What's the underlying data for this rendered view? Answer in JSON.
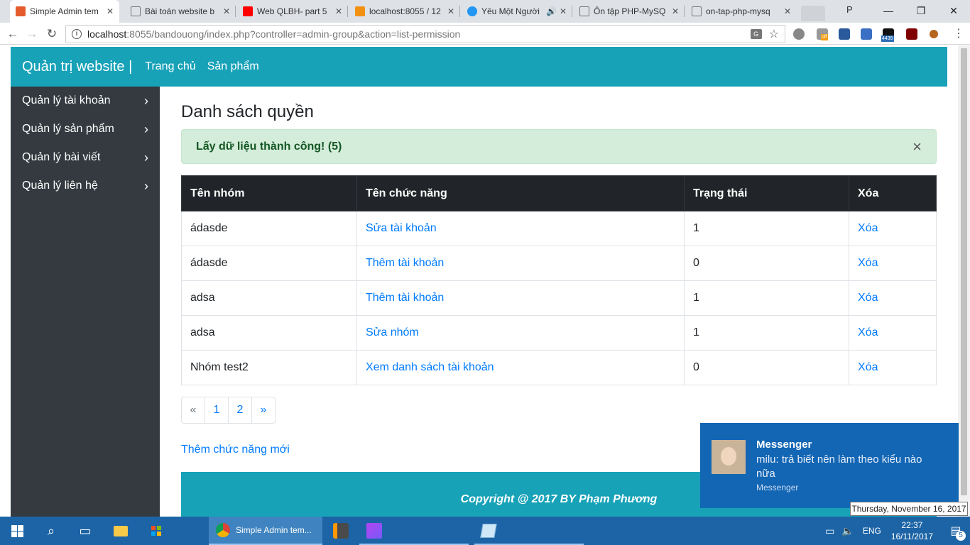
{
  "browser": {
    "tabs": [
      {
        "title": "Simple Admin tem",
        "icon_color": "#e45c2c",
        "active": true
      },
      {
        "title": "Bài toán website b",
        "icon_color": "#9e9e9e",
        "active": false
      },
      {
        "title": "Web QLBH- part 5",
        "icon_color": "#ff0000",
        "active": false
      },
      {
        "title": "localhost:8055 / 12",
        "icon_color": "#f29111",
        "active": false
      },
      {
        "title": "Yêu Một Người",
        "icon_color": "#2196f3",
        "active": false
      },
      {
        "title": "Ôn tập PHP-MySQ",
        "icon_color": "#9e9e9e",
        "active": false
      },
      {
        "title": "on-tap-php-mysq",
        "icon_color": "#9e9e9e",
        "active": false
      }
    ],
    "profile_label": "P",
    "address_host": "localhost",
    "address_rest": ":8055/bandouong/index.php?controller=admin-group&action=list-permission",
    "ext_badge": "4435",
    "ext_off": "off"
  },
  "site": {
    "brand": "Quản trị website |",
    "nav": [
      "Trang chủ",
      "Sản phẩm"
    ],
    "sidebar": [
      "Quản lý tài khoản",
      "Quản lý sản phẩm",
      "Quản lý bài viết",
      "Quản lý liên hệ"
    ],
    "page_title": "Danh sách quyền",
    "alert": "Lấy dữ liệu thành công! (5)",
    "alert_close": "×",
    "table": {
      "headers": [
        "Tên nhóm",
        "Tên chức năng",
        "Trạng thái",
        "Xóa"
      ],
      "rows": [
        [
          "ádasde",
          "Sửa tài khoản",
          "1",
          "Xóa"
        ],
        [
          "ádasde",
          "Thêm tài khoản",
          "0",
          "Xóa"
        ],
        [
          "adsa",
          "Thêm tài khoản",
          "1",
          "Xóa"
        ],
        [
          "adsa",
          "Sửa nhóm",
          "1",
          "Xóa"
        ],
        [
          "Nhóm test2",
          "Xem danh sách tài khoản",
          "0",
          "Xóa"
        ]
      ]
    },
    "pagination": [
      "«",
      "1",
      "2",
      "»"
    ],
    "add_link": "Thêm chức năng mới",
    "footer": "Copyright @ 2017 BY Phạm Phương"
  },
  "notification": {
    "title": "Messenger",
    "body": "milu: trả biết nên làm theo kiểu nào nữa",
    "source": "Messenger"
  },
  "tooltip": "Thursday, November 16, 2017",
  "taskbar": {
    "active_app": "Simple Admin tem...",
    "language": "ENG",
    "time": "22:37",
    "date": "16/11/2017",
    "notification_count": "5"
  }
}
